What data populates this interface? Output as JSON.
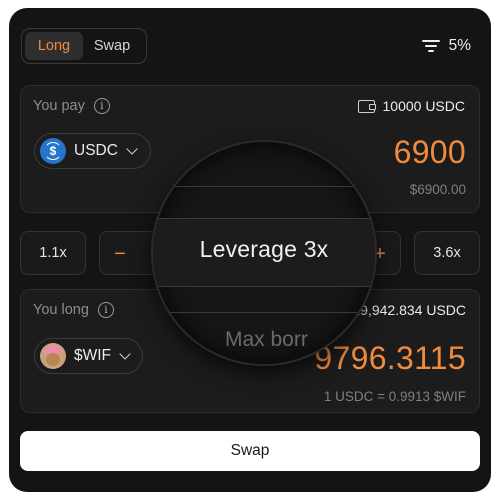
{
  "tabs": [
    {
      "label": "Long",
      "active": true
    },
    {
      "label": "Swap",
      "active": false
    }
  ],
  "slippage": {
    "icon": "filter-icon",
    "value": "5%"
  },
  "pay": {
    "label": "You pay",
    "balance": "10000 USDC",
    "token": "USDC",
    "amount": "6900",
    "usd_value": "$6900.00"
  },
  "leverage": {
    "min": "1.1x",
    "max": "3.6x",
    "value_text": "Leverage 3x",
    "minus": "−",
    "plus": "+"
  },
  "long": {
    "label": "You long",
    "right_info": ": 19,942.834 USDC",
    "ghost_text": "Max borr",
    "token": "$WIF",
    "amount": "9796.3115",
    "rate": "1 USDC = 0.9913 $WIF"
  },
  "action": {
    "label": "Swap"
  },
  "colors": {
    "accent": "#f08a3e",
    "background": "#141414",
    "card": "#1c1c1c",
    "usdc": "#2775ca"
  }
}
